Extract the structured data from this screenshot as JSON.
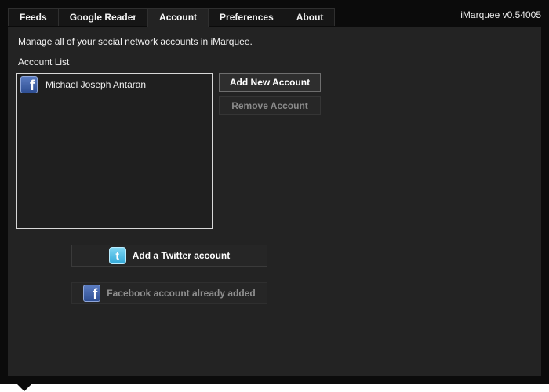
{
  "tabs": [
    {
      "label": "Feeds",
      "active": false
    },
    {
      "label": "Google Reader",
      "active": false
    },
    {
      "label": "Account",
      "active": true
    },
    {
      "label": "Preferences",
      "active": false
    },
    {
      "label": "About",
      "active": false
    }
  ],
  "app": {
    "version": "iMarquee v0.54005"
  },
  "account": {
    "description": "Manage all of your social network accounts in iMarquee.",
    "list_title": "Account List",
    "accounts": [
      {
        "name": "Michael Joseph Antaran",
        "icon": "facebook-icon"
      }
    ],
    "add_label": "Add New Account",
    "remove_label": "Remove Account",
    "twitter_label": "Add a Twitter account",
    "facebook_label": "Facebook account already added"
  },
  "colors": {
    "background": "#0b0b0b",
    "panel": "#232323",
    "text": "#f0f0f0",
    "disabled_text": "#8a8a8a",
    "facebook_blue": "#3b5998",
    "twitter_blue": "#33ccff"
  }
}
